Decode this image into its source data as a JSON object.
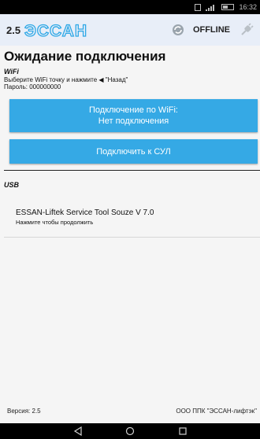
{
  "status_bar": {
    "time": "16:32"
  },
  "header": {
    "version_number": "2.5",
    "logo_text": "ЭССАН",
    "connection_status": "OFFLINE"
  },
  "page_title": "Ожидание подключения",
  "wifi": {
    "section_label": "WiFi",
    "instruction_before": "Выберите WiFi точку и нажмите",
    "instruction_back": "\"Назад\"",
    "password_line": "Пароль: 000000000",
    "wifi_button_line1": "Подключение по WiFi:",
    "wifi_button_line2": "Нет подключения",
    "connect_button_label": "Подключить к СУЛ"
  },
  "usb": {
    "section_label": "USB",
    "device_title": "ESSAN-Liftek Service Tool Souze V 7.0",
    "device_subtitle": "Нажмите чтобы продолжить"
  },
  "footer": {
    "version_label": "Версия:",
    "version_value": "2.5",
    "company": "ООО ППК \"ЭССАН-лифтэк\""
  },
  "colors": {
    "accent": "#35a9e5",
    "header_bg": "#e8eef8",
    "logo": "#2ea8e6"
  }
}
